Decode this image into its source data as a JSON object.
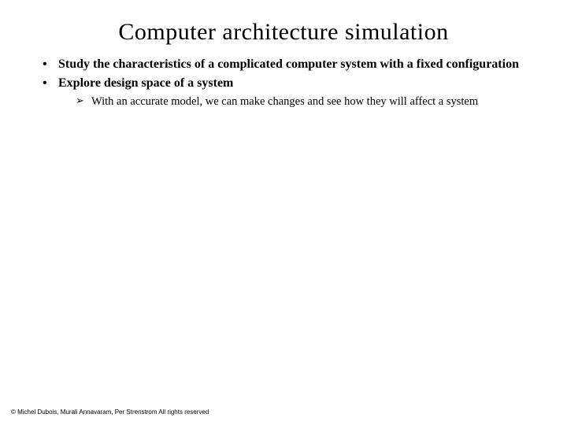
{
  "title": "Computer architecture simulation",
  "bullets": [
    {
      "text": "Study the characteristics of a complicated computer system with a fixed configuration",
      "sub": []
    },
    {
      "text": "Explore design space of a system",
      "sub": [
        {
          "text": "With an accurate model, we can make changes and see how they will affect a system"
        }
      ]
    }
  ],
  "footer": "© Michel Dubois, Murali Annavaram, Per Strenstrom All rights reserved"
}
